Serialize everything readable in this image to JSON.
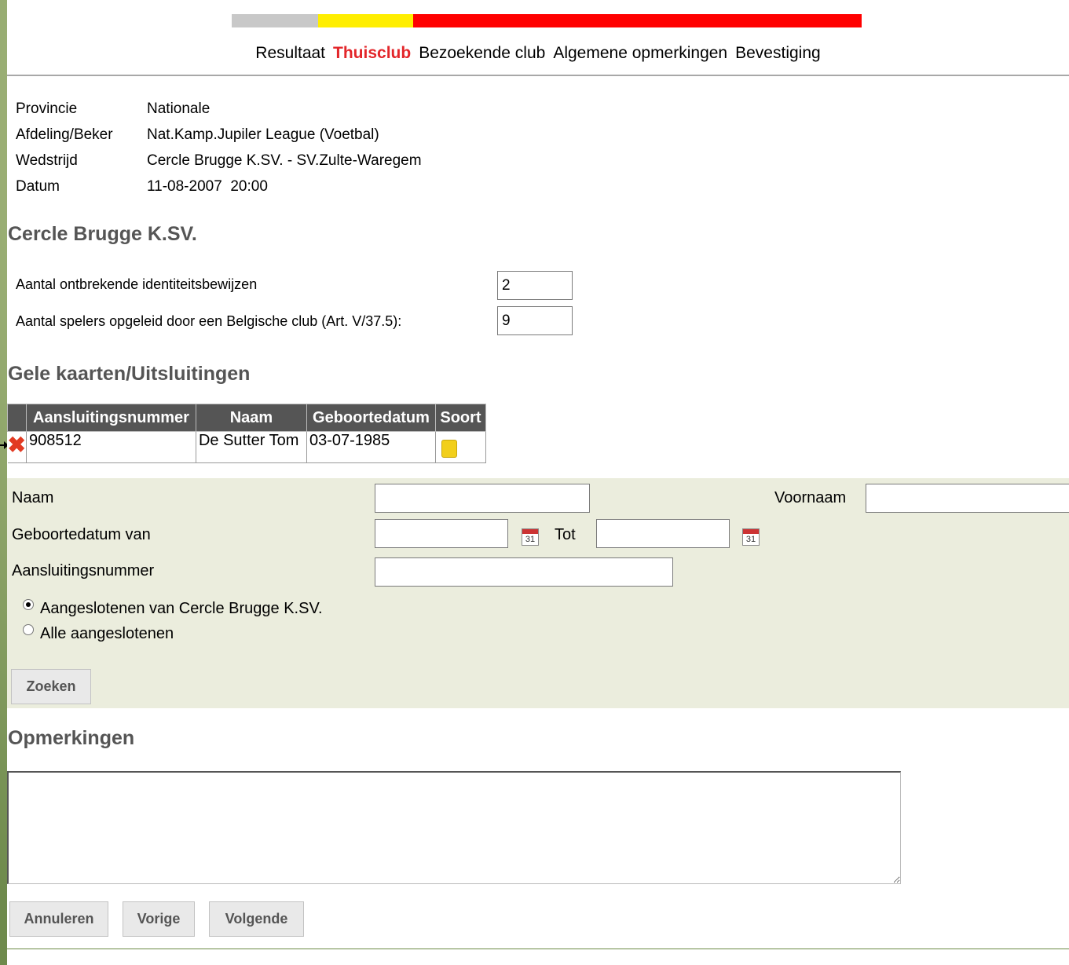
{
  "progress": {
    "colors": [
      "#c8c8c8",
      "#ffee00",
      "#ff0000"
    ]
  },
  "steps": [
    "Resultaat",
    "Thuisclub",
    "Bezoekende club",
    "Algemene opmerkingen",
    "Bevestiging"
  ],
  "active_step": "Thuisclub",
  "match": {
    "provincie_label": "Provincie",
    "provincie_value": "Nationale",
    "afdeling_label": "Afdeling/Beker",
    "afdeling_value": "Nat.Kamp.Jupiler League (Voetbal)",
    "wedstrijd_label": "Wedstrijd",
    "wedstrijd_value": "Cercle Brugge K.SV. - SV.Zulte-Waregem",
    "datum_label": "Datum",
    "datum_value": "11-08-2007  20:00"
  },
  "club_title": "Cercle Brugge K.SV.",
  "counts": {
    "missing_id_label": "Aantal ontbrekende identiteitsbewijzen",
    "missing_id_value": "2",
    "trained_label": "Aantal spelers opgeleid door een Belgische club (Art. V/37.5):",
    "trained_value": "9"
  },
  "cards_title": "Gele kaarten/Uitsluitingen",
  "cards_table": {
    "headers": [
      "Aansluitingsnummer",
      "Naam",
      "Geboortedatum",
      "Soort"
    ],
    "rows": [
      {
        "number": "908512",
        "name": "De Sutter Tom",
        "birthdate": "03-07-1985",
        "kind": "yellow-card"
      }
    ]
  },
  "search": {
    "naam_label": "Naam",
    "naam_value": "",
    "voornaam_label": "Voornaam",
    "voornaam_value": "",
    "geb_van_label": "Geboortedatum van",
    "geb_van_value": "",
    "tot_label": "Tot",
    "tot_value": "",
    "aansl_label": "Aansluitingsnummer",
    "aansl_value": "",
    "radio1_label": "Aangeslotenen van Cercle Brugge K.SV.",
    "radio2_label": "Alle aangeslotenen",
    "selected_radio": 1,
    "button_label": "Zoeken",
    "calendar_day": "31"
  },
  "opm_title": "Opmerkingen",
  "opm_value": "",
  "buttons": {
    "cancel": "Annuleren",
    "prev": "Vorige",
    "next": "Volgende"
  }
}
